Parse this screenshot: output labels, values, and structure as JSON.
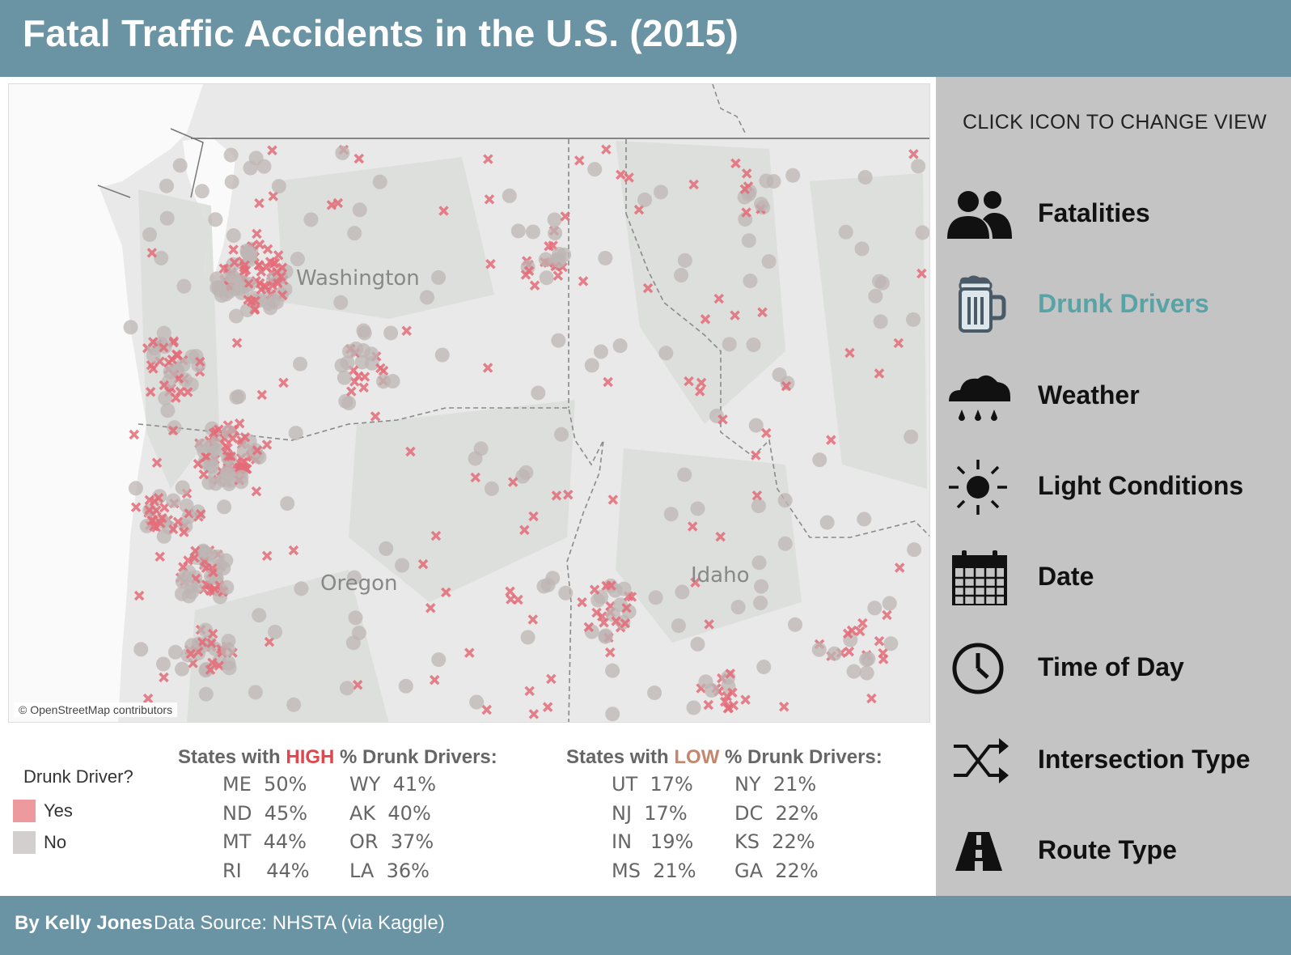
{
  "header": {
    "title": "Fatal Traffic Accidents in the U.S. (2015)"
  },
  "map": {
    "state_labels": {
      "washington": "Washington",
      "oregon": "Oregon",
      "idaho": "Idaho"
    },
    "attribution": "© OpenStreetMap contributors",
    "colors": {
      "yes": "#e46c78",
      "no": "#bdb6b4",
      "land": "#e8e9e8",
      "water": "#ffffff",
      "border": "#888888"
    }
  },
  "legend": {
    "title": "Drunk Driver?",
    "items": [
      {
        "label": "Yes",
        "color": "#ed9a9f"
      },
      {
        "label": "No",
        "color": "#d3cfcf"
      }
    ]
  },
  "high_states": {
    "title_pre": "States with ",
    "title_hl": "HIGH",
    "title_post": " % Drunk Drivers:",
    "hl_color": "#e0474c",
    "col1": [
      "ME  50%",
      "ND  45%",
      "MT  44%",
      "RI    44%"
    ],
    "col2": [
      "WY  41%",
      "AK  40%",
      "OR  37%",
      "LA  36%"
    ]
  },
  "low_states": {
    "title_pre": "States with ",
    "title_hl": "LOW",
    "title_post": " % Drunk Drivers:",
    "hl_color": "#c4876d",
    "col1": [
      "UT  17%",
      "NJ  17%",
      "IN   19%",
      "MS  21%"
    ],
    "col2": [
      "NY  21%",
      "DC  22%",
      "KS  22%",
      "GA  22%"
    ]
  },
  "panel": {
    "title": "CLICK ICON TO CHANGE VIEW",
    "items": [
      {
        "label": "Fatalities",
        "icon": "people-icon",
        "active": false
      },
      {
        "label": "Drunk Drivers",
        "icon": "beer-mug-icon",
        "active": true
      },
      {
        "label": "Weather",
        "icon": "rain-cloud-icon",
        "active": false
      },
      {
        "label": "Light Conditions",
        "icon": "sun-icon",
        "active": false
      },
      {
        "label": "Date",
        "icon": "calendar-icon",
        "active": false
      },
      {
        "label": "Time of Day",
        "icon": "clock-icon",
        "active": false
      },
      {
        "label": "Intersection Type",
        "icon": "shuffle-icon",
        "active": false
      },
      {
        "label": "Route Type",
        "icon": "road-icon",
        "active": false
      }
    ],
    "active_color": "#58a3a6"
  },
  "footer": {
    "author": "By Kelly Jones",
    "source": "Data Source: NHSTA (via Kaggle)"
  }
}
